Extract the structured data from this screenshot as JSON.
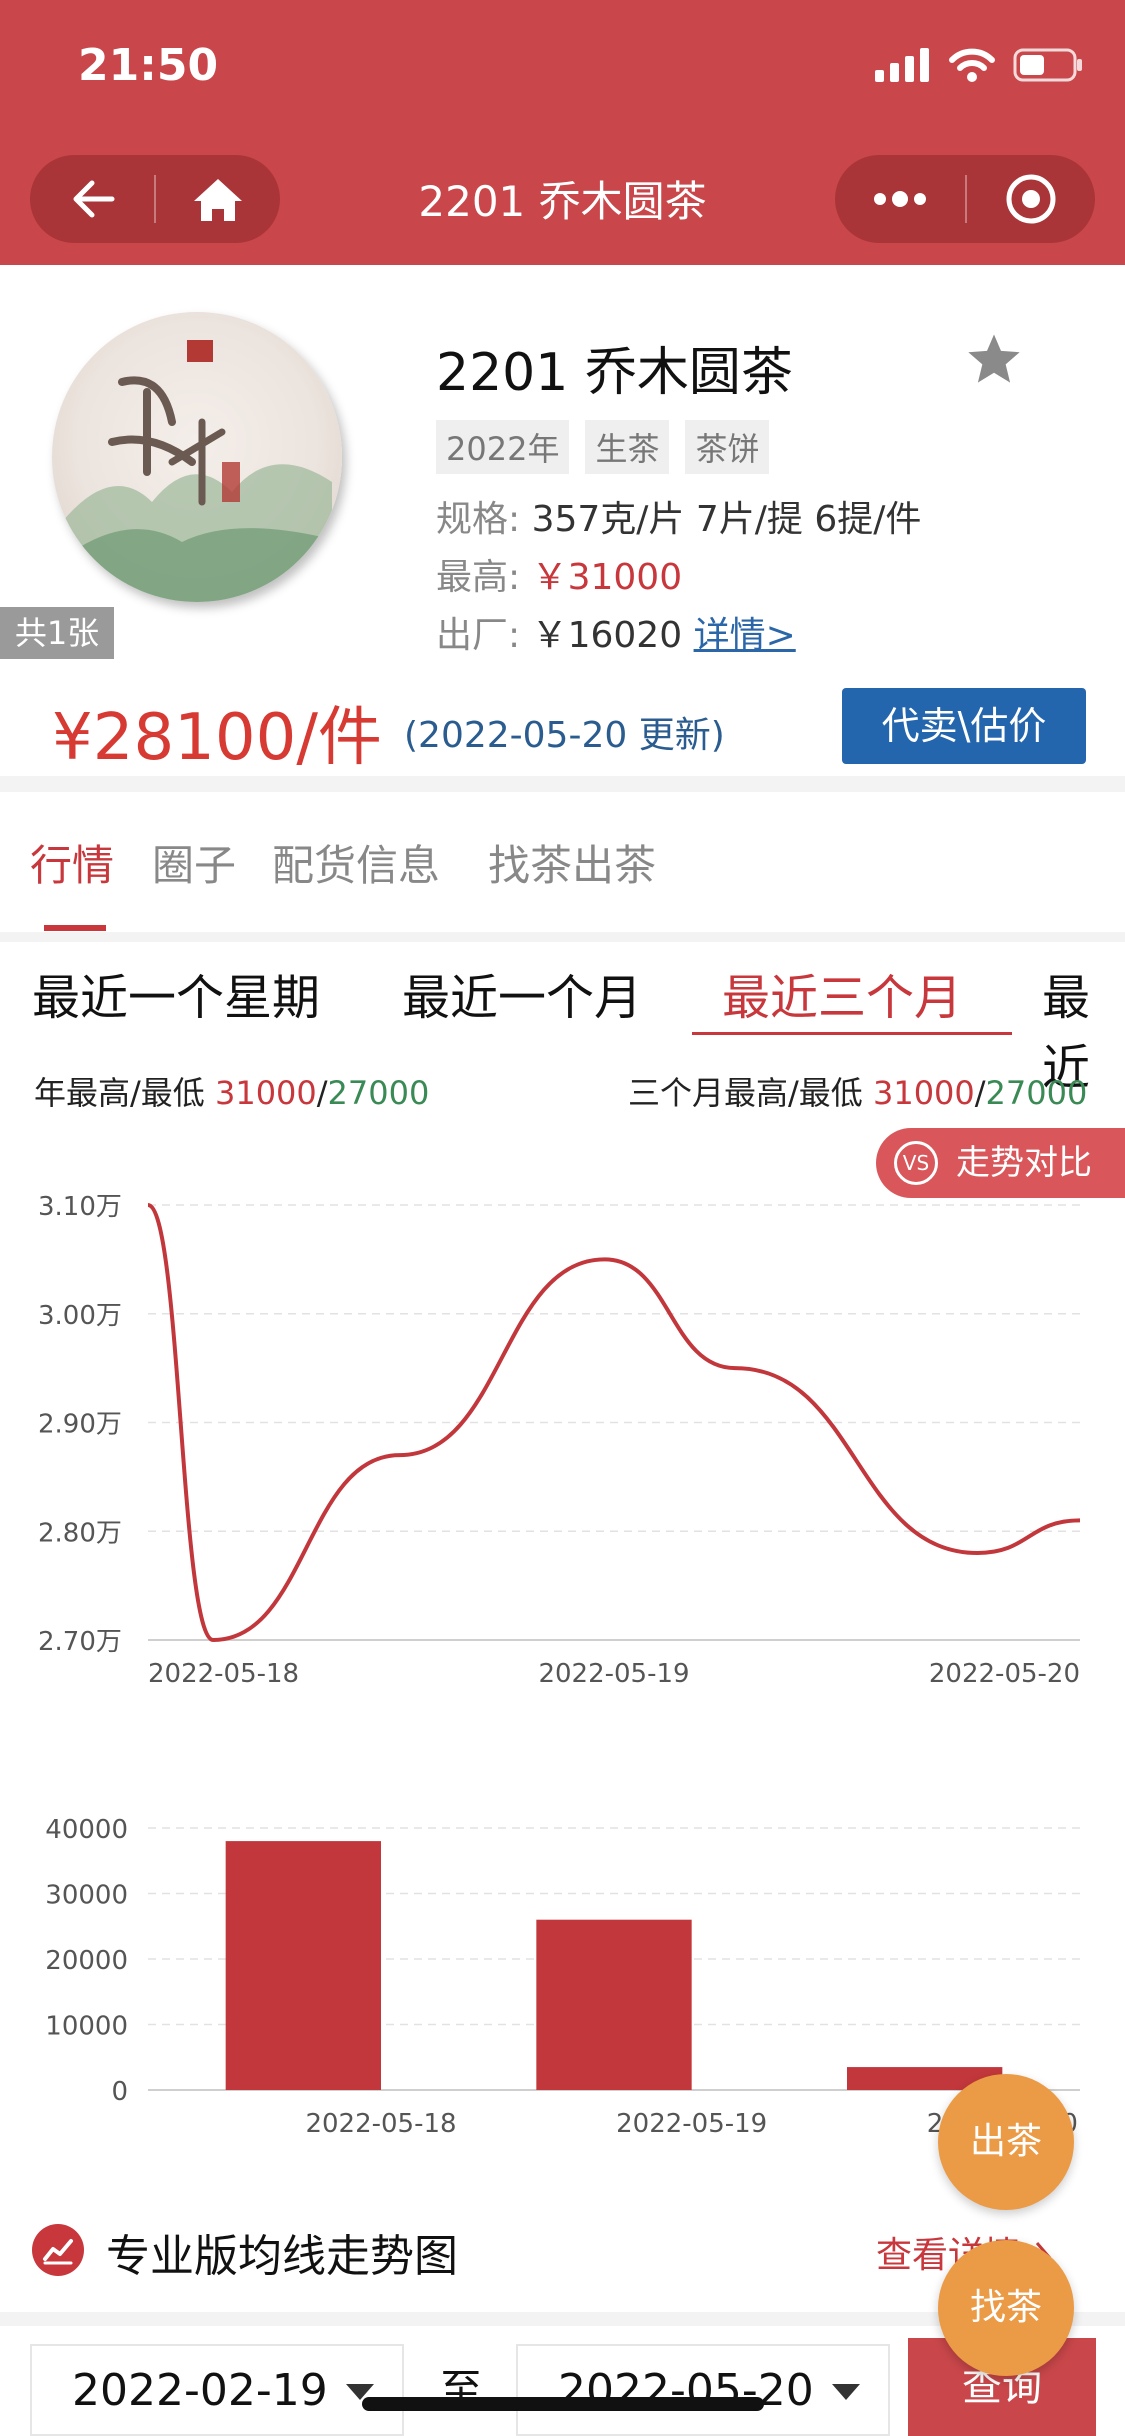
{
  "status_bar": {
    "time": "21:50"
  },
  "nav": {
    "title": "2201 乔木圆茶"
  },
  "product": {
    "title": "2201 乔木圆茶",
    "count_badge": "共1张",
    "tags": [
      "2022年",
      "生茶",
      "茶饼"
    ],
    "spec_label": "规格:",
    "spec_value": "357克/片 7片/提 6提/件",
    "high_label": "最高:",
    "high_value": "￥31000",
    "factory_label": "出厂:",
    "factory_value": "￥16020",
    "details_link": "详情>",
    "price": "¥28100/件",
    "updated": "(2022-05-20 更新)",
    "sell_button": "代卖\\估价"
  },
  "tabs": [
    "行情",
    "圈子",
    "配货信息",
    "找茶出茶"
  ],
  "period_tabs": [
    "最近一个星期",
    "最近一个月",
    "最近三个月",
    "最近"
  ],
  "stats": {
    "year_label": "年最高/最低",
    "year_high": "31000",
    "year_low": "27000",
    "q_label": "三个月最高/最低",
    "q_high": "31000",
    "q_low": "27000",
    "slash": "/"
  },
  "compare_button": {
    "vs": "VS",
    "label": "走势对比"
  },
  "chart_data": [
    {
      "type": "line",
      "x": [
        "2022-05-18",
        "2022-05-18",
        "2022-05-18",
        "2022-05-19",
        "2022-05-19",
        "2022-05-20",
        "2022-05-20"
      ],
      "x_ticks": [
        "2022-05-18",
        "2022-05-19",
        "2022-05-20"
      ],
      "y": [
        31000,
        27000,
        28700,
        30500,
        29500,
        27800,
        28100
      ],
      "y_ticks": [
        "2.70万",
        "2.80万",
        "2.90万",
        "3.00万",
        "3.10万"
      ],
      "ylim": [
        27000,
        31000
      ],
      "grid": true,
      "color": "#c2373b"
    },
    {
      "type": "bar",
      "categories": [
        "2022-05-18",
        "2022-05-19",
        "2022-05-20"
      ],
      "values": [
        38000,
        26000,
        3500
      ],
      "y_ticks": [
        "0",
        "10000",
        "20000",
        "30000",
        "40000"
      ],
      "ylim": [
        0,
        40000
      ],
      "grid": true,
      "color": "#c2373b"
    }
  ],
  "moving_avg": {
    "title": "专业版均线走势图",
    "link": "查看详情"
  },
  "fabs": {
    "sell": "出茶",
    "find": "找茶"
  },
  "query": {
    "from": "2022-02-19",
    "to_label": "至",
    "to": "2022-05-20",
    "button": "查询"
  },
  "colors": {
    "header": "#c9474a",
    "accent": "#c7373b",
    "button_blue": "#2466ae",
    "fab": "#eb9a45",
    "green": "#3a8a55"
  }
}
